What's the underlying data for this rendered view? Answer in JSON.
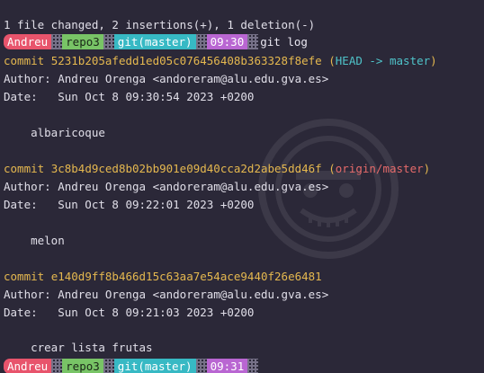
{
  "summary_line": "1 file changed, 2 insertions(+), 1 deletion(-)",
  "prompt_1": {
    "user": "Andreu",
    "repo": "repo3",
    "git": "git(master)",
    "time": "09:30",
    "command": "git log"
  },
  "commits": [
    {
      "prefix": "commit ",
      "hash": "5231b205afedd1ed05c076456408b363328f8efe",
      "ref_open": " (",
      "ref_head": "HEAD -> master",
      "ref_close": ")",
      "author": "Author: Andreu Orenga <andoreram@alu.edu.gva.es>",
      "date": "Date:   Sun Oct 8 09:30:54 2023 +0200",
      "message": "    albaricoque"
    },
    {
      "prefix": "commit ",
      "hash": "3c8b4d9ced8b02bb901e09d40cca2d2abe5dd46f",
      "ref_open": " (",
      "ref_remote": "origin/master",
      "ref_close": ")",
      "author": "Author: Andreu Orenga <andoreram@alu.edu.gva.es>",
      "date": "Date:   Sun Oct 8 09:22:01 2023 +0200",
      "message": "    melon"
    },
    {
      "prefix": "commit ",
      "hash": "e140d9ff8b466d15c63aa7e54ace9440f26e6481",
      "author": "Author: Andreu Orenga <andoreram@alu.edu.gva.es>",
      "date": "Date:   Sun Oct 8 09:21:03 2023 +0200",
      "message": "    crear lista frutas"
    }
  ],
  "prompt_2": {
    "user": "Andreu",
    "repo": "repo3",
    "git": "git(master)",
    "time": "09:31"
  },
  "colors": {
    "background": "#2b2838",
    "user_segment": "#e8546c",
    "repo_segment": "#78c466",
    "git_segment": "#37b9c4",
    "time_segment": "#b966d2",
    "commit_hash": "#e5b84f",
    "head_ref": "#4fc3c9",
    "remote_ref": "#e56a6a"
  },
  "icons": {
    "watermark": "skull-emblem-icon",
    "separator": "dotted-separator-icon"
  }
}
